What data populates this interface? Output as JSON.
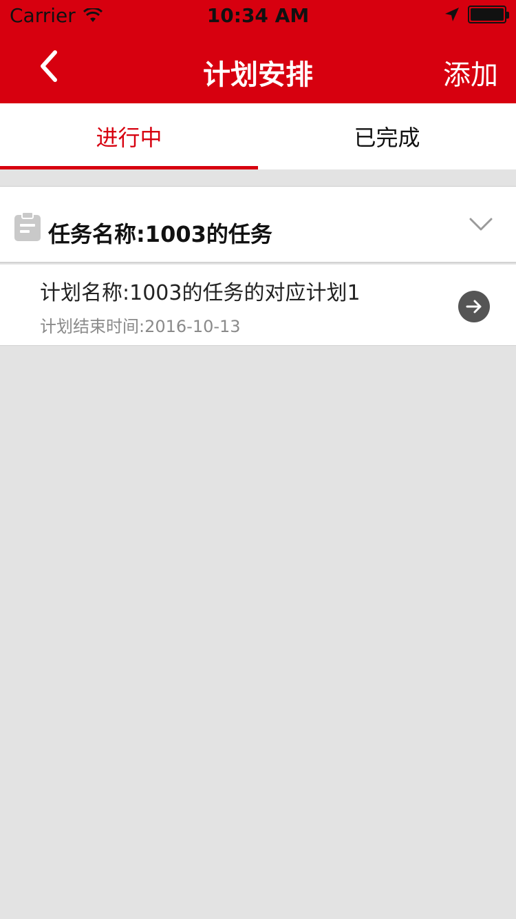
{
  "status_bar": {
    "carrier": "Carrier",
    "time": "10:34 AM"
  },
  "nav": {
    "title": "计划安排",
    "add_label": "添加"
  },
  "tabs": [
    {
      "label": "进行中",
      "active": true
    },
    {
      "label": "已完成",
      "active": false
    }
  ],
  "task": {
    "title": "任务名称:1003的任务",
    "plans": [
      {
        "name": "计划名称:1003的任务的对应计划1",
        "end_date": "计划结束时间:2016-10-13"
      }
    ]
  },
  "colors": {
    "brand": "#d7000f",
    "background": "#e3e3e3"
  }
}
